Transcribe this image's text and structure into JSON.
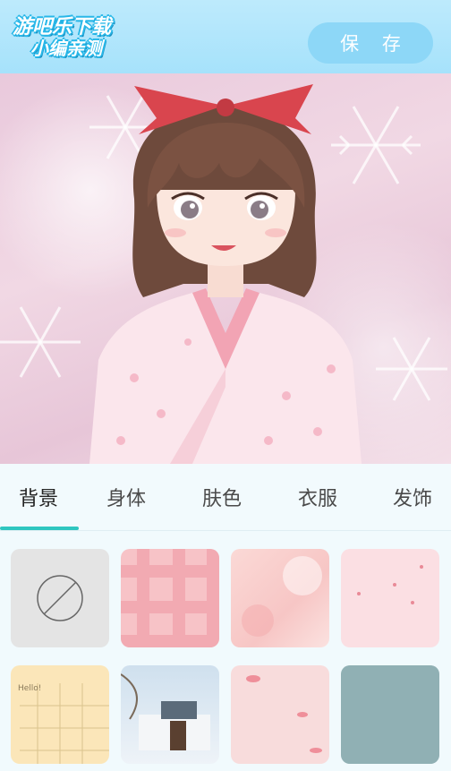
{
  "header": {
    "logo_line1": "游吧乐下载",
    "logo_line2": "小编亲测",
    "save_label": "保 存"
  },
  "tabs": [
    {
      "label": "背景",
      "active": true
    },
    {
      "label": "身体",
      "active": false
    },
    {
      "label": "肤色",
      "active": false
    },
    {
      "label": "衣服",
      "active": false
    },
    {
      "label": "发饰",
      "active": false
    }
  ],
  "backgrounds": [
    {
      "name": "none",
      "icon": "prohibited-icon"
    },
    {
      "name": "pink-plaid"
    },
    {
      "name": "pink-floral-watercolor"
    },
    {
      "name": "pink-hearts"
    },
    {
      "name": "yellow-notebook",
      "text": "Hello!"
    },
    {
      "name": "winter-courtyard"
    },
    {
      "name": "pink-petals"
    },
    {
      "name": "teal-paper"
    }
  ],
  "colors": {
    "accent": "#2fc6c0",
    "header": "#a6e2fb",
    "save_button": "#8dd7f7"
  }
}
